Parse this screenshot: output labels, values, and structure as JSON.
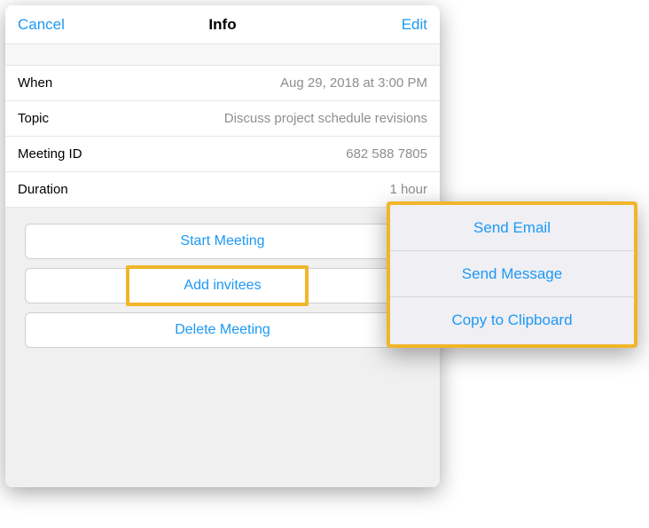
{
  "header": {
    "cancel": "Cancel",
    "title": "Info",
    "edit": "Edit"
  },
  "details": {
    "when_label": "When",
    "when_value": "Aug 29, 2018 at 3:00 PM",
    "topic_label": "Topic",
    "topic_value": "Discuss project schedule revisions",
    "meetingid_label": "Meeting ID",
    "meetingid_value": "682 588 7805",
    "duration_label": "Duration",
    "duration_value": "1 hour"
  },
  "actions": {
    "start": "Start Meeting",
    "add_invitees": "Add invitees",
    "delete": "Delete Meeting"
  },
  "popover": {
    "send_email": "Send Email",
    "send_message": "Send Message",
    "copy_clipboard": "Copy to Clipboard"
  },
  "colors": {
    "accent": "#1d99f3",
    "highlight": "#f1b52a"
  }
}
